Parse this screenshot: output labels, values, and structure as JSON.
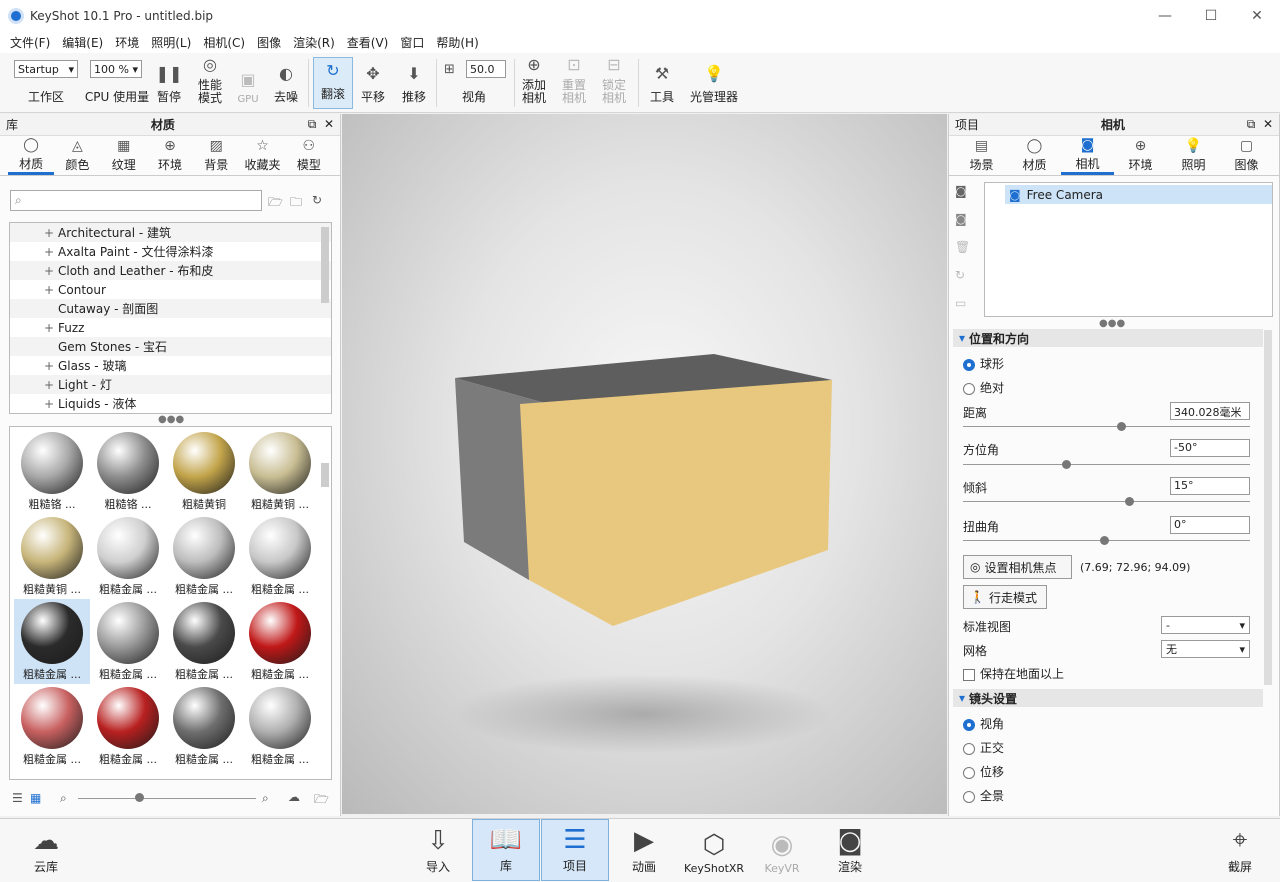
{
  "window": {
    "title": "KeyShot 10.1 Pro  - untitled.bip",
    "controls": [
      "—",
      "☐",
      "✕"
    ]
  },
  "menu": [
    "文件(F)",
    "编辑(E)",
    "环境",
    "照明(L)",
    "相机(C)",
    "图像",
    "渲染(R)",
    "查看(V)",
    "窗口",
    "帮助(H)"
  ],
  "toolbar": {
    "workspace_value": "Startup",
    "workspace_label": "工作区",
    "cpu_value": "100 %",
    "cpu_label": "CPU 使用量",
    "pause": "暂停",
    "perf1": "性能",
    "perf2": "模式",
    "gpu": "GPU",
    "denoise": "去噪",
    "tumble": "翻滚",
    "pan": "平移",
    "dolly": "推移",
    "fov_value": "50.0",
    "fov_label": "视角",
    "add1": "添加",
    "add2": "相机",
    "reset1": "重置",
    "reset2": "相机",
    "lock1": "锁定",
    "lock2": "相机",
    "tools": "工具",
    "light_manager": "光管理器"
  },
  "library": {
    "header_left": "库",
    "header_title": "材质",
    "tabs": [
      "材质",
      "颜色",
      "纹理",
      "环境",
      "背景",
      "收藏夹",
      "模型"
    ],
    "tree": [
      {
        "pm": "+",
        "label": "Architectural - 建筑"
      },
      {
        "pm": "+",
        "label": "Axalta Paint - 文仕得涂料漆"
      },
      {
        "pm": "+",
        "label": "Cloth and Leather - 布和皮"
      },
      {
        "pm": "+",
        "label": "Contour"
      },
      {
        "pm": "",
        "label": "Cutaway - 剖面图"
      },
      {
        "pm": "+",
        "label": "Fuzz"
      },
      {
        "pm": "",
        "label": "Gem Stones - 宝石"
      },
      {
        "pm": "+",
        "label": "Glass - 玻璃"
      },
      {
        "pm": "+",
        "label": "Light - 灯"
      },
      {
        "pm": "+",
        "label": "Liquids - 液体"
      }
    ],
    "thumbs": [
      {
        "label": "粗糙铬 ...",
        "color": "#a8a8a8"
      },
      {
        "label": "粗糙铬 ...",
        "color": "#8d8d8d"
      },
      {
        "label": "粗糙黄铜",
        "color": "#c2a44a"
      },
      {
        "label": "粗糙黄铜 ...",
        "color": "#c8bd92"
      },
      {
        "label": "粗糙黄铜 ...",
        "color": "#c7b57a"
      },
      {
        "label": "粗糙金属 ...",
        "color": "#cfcfcf"
      },
      {
        "label": "粗糙金属 ...",
        "color": "#bdbdbd"
      },
      {
        "label": "粗糙金属 ...",
        "color": "#c8c8c8"
      },
      {
        "label": "粗糙金属 ...",
        "color": "#2b2b2b"
      },
      {
        "label": "粗糙金属 ...",
        "color": "#9a9a9a"
      },
      {
        "label": "粗糙金属 ...",
        "color": "#4a4a4a"
      },
      {
        "label": "粗糙金属 ...",
        "color": "#c01818"
      },
      {
        "label": "粗糙金属 ...",
        "color": "#c86060"
      },
      {
        "label": "粗糙金属 ...",
        "color": "#b82020"
      },
      {
        "label": "粗糙金属 ...",
        "color": "#6e6e6e"
      },
      {
        "label": "粗糙金属 ...",
        "color": "#b0b0b0"
      }
    ]
  },
  "project": {
    "header_left": "项目",
    "header_title": "相机",
    "tabs": [
      "场景",
      "材质",
      "相机",
      "环境",
      "照明",
      "图像"
    ],
    "camera_item": "Free Camera",
    "section_position": "位置和方向",
    "spherical": "球形",
    "absolute": "绝对",
    "distance_label": "距离",
    "distance_value": "340.028毫米",
    "distance_fraction": 0.55,
    "azimuth_label": "方位角",
    "azimuth_value": "-50°",
    "azimuth_fraction": 0.36,
    "inclination_label": "倾斜",
    "inclination_value": "15°",
    "inclination_fraction": 0.58,
    "twist_label": "扭曲角",
    "twist_value": "0°",
    "twist_fraction": 0.49,
    "focus_button": "设置相机焦点",
    "focus_coords": "(7.69; 72.96; 94.09)",
    "walk_button": "行走模式",
    "std_view_label": "标准视图",
    "std_view_value": "-",
    "grid_label": "网格",
    "grid_value": "无",
    "keep_above": "保持在地面以上",
    "section_lens": "镜头设置",
    "lens_options": [
      "视角",
      "正交",
      "位移",
      "全景"
    ]
  },
  "bottom": {
    "cloud": "云库",
    "import": "导入",
    "library": "库",
    "project": "项目",
    "animation": "动画",
    "xr": "KeyShotXR",
    "vr": "KeyVR",
    "render": "渲染",
    "screenshot": "截屏"
  },
  "colors": {
    "accent": "#1e6fd0",
    "box_front": "#e8c87e",
    "box_side": "#7b7b7b",
    "box_top": "#5e5e5e"
  }
}
